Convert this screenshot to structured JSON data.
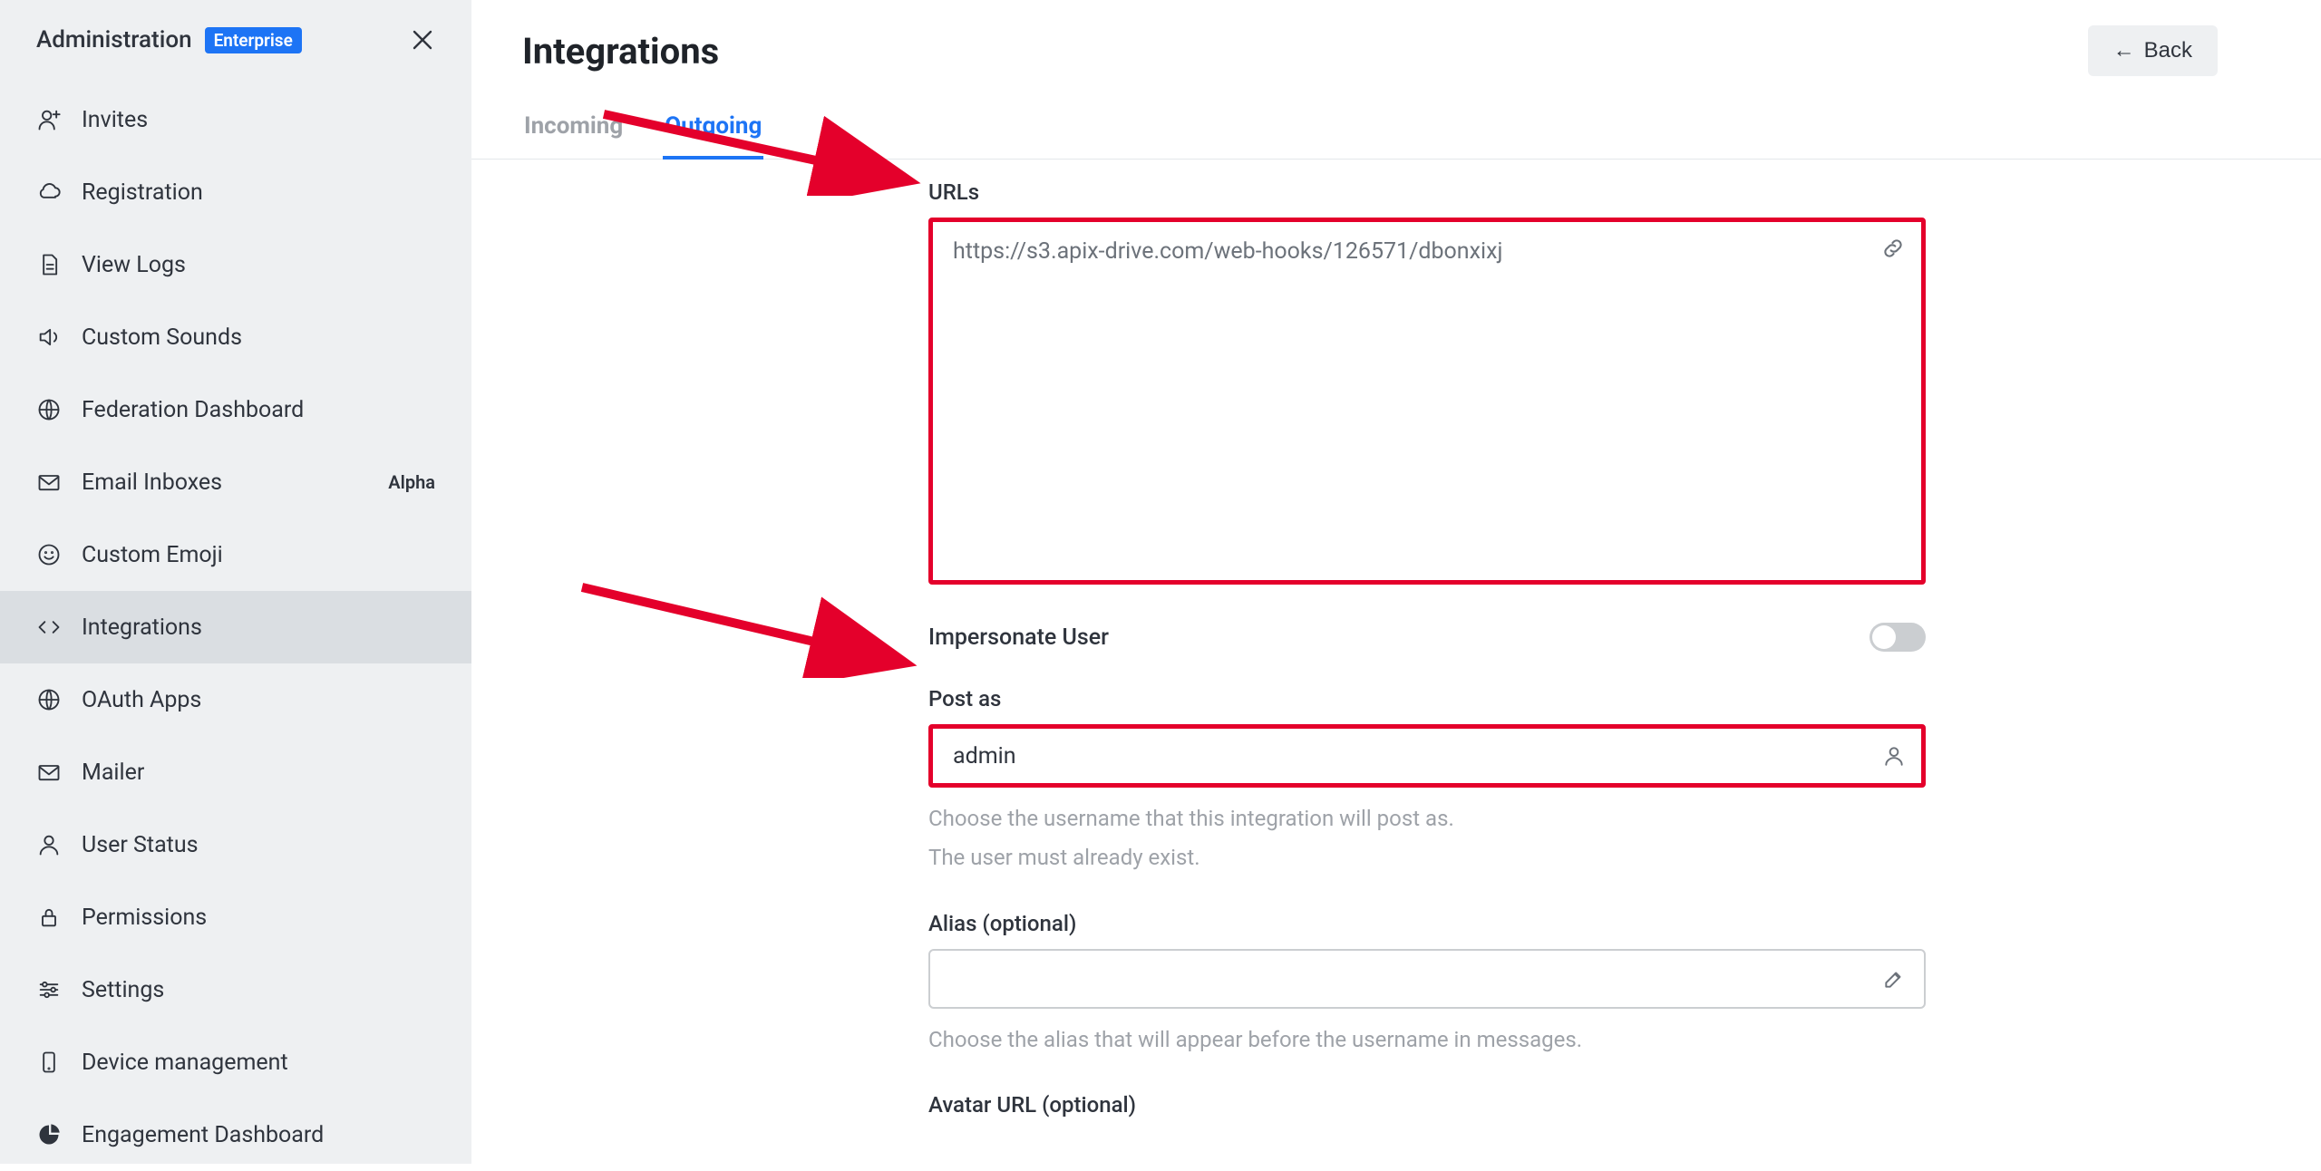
{
  "sidebar": {
    "title": "Administration",
    "badge": "Enterprise",
    "items": [
      {
        "label": "Invites"
      },
      {
        "label": "Registration"
      },
      {
        "label": "View Logs"
      },
      {
        "label": "Custom Sounds"
      },
      {
        "label": "Federation Dashboard"
      },
      {
        "label": "Email Inboxes",
        "tag": "Alpha"
      },
      {
        "label": "Custom Emoji"
      },
      {
        "label": "Integrations"
      },
      {
        "label": "OAuth Apps"
      },
      {
        "label": "Mailer"
      },
      {
        "label": "User Status"
      },
      {
        "label": "Permissions"
      },
      {
        "label": "Settings"
      },
      {
        "label": "Device management"
      },
      {
        "label": "Engagement Dashboard"
      }
    ]
  },
  "header": {
    "title": "Integrations",
    "back": "Back"
  },
  "tabs": {
    "incoming": "Incoming",
    "outgoing": "Outgoing"
  },
  "form": {
    "urls_label": "URLs",
    "urls_value": "https://s3.apix-drive.com/web-hooks/126571/dbonxixj",
    "impersonate_label": "Impersonate User",
    "impersonate_value": false,
    "postas_label": "Post as",
    "postas_value": "admin",
    "postas_help1": "Choose the username that this integration will post as.",
    "postas_help2": "The user must already exist.",
    "alias_label": "Alias (optional)",
    "alias_value": "",
    "alias_help": "Choose the alias that will appear before the username in messages.",
    "avatar_label": "Avatar URL (optional)"
  }
}
